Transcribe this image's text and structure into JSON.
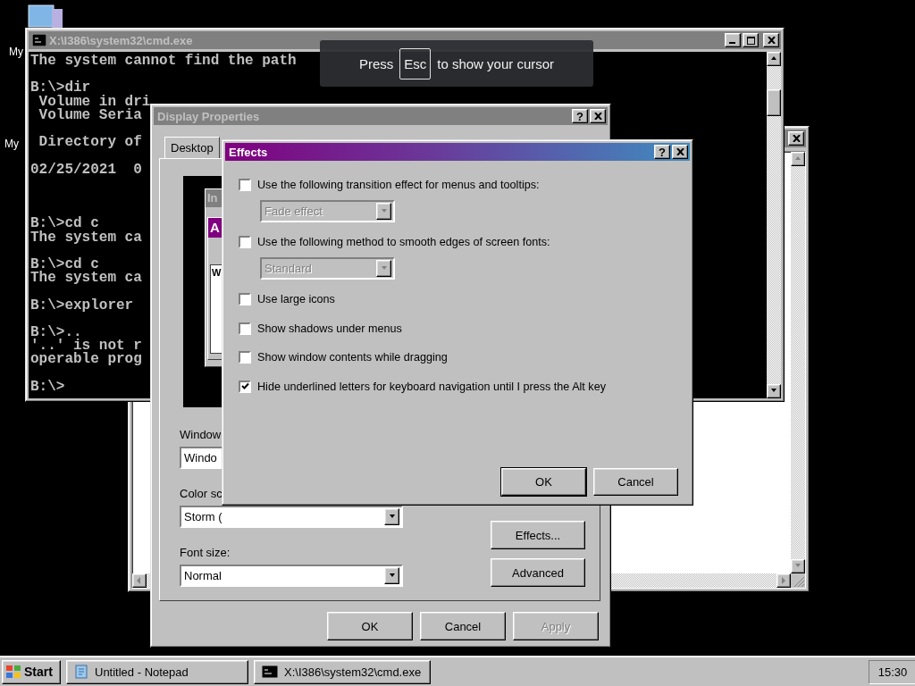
{
  "desktop": {
    "icon_labels": [
      "My",
      "My"
    ]
  },
  "cmd_window": {
    "title": "X:\\I386\\system32\\cmd.exe",
    "active": false,
    "blocks": [
      {
        "kind": "command",
        "lines": [
          "The system cannot find the path"
        ]
      },
      {
        "kind": "command",
        "lines": [
          "B:\\>dir",
          " Volume in dri",
          " Volume Seria"
        ]
      },
      {
        "kind": "command",
        "lines": [
          " Directory of"
        ]
      },
      {
        "kind": "listing",
        "lines": [
          "02/25/2021  0"
        ]
      },
      {
        "kind": "command",
        "lines": [
          "B:\\>cd c",
          "The system ca"
        ]
      },
      {
        "kind": "command",
        "lines": [
          "B:\\>cd c",
          "The system ca"
        ]
      },
      {
        "kind": "command",
        "lines": [
          "B:\\>explorer"
        ]
      },
      {
        "kind": "command",
        "lines": [
          "B:\\>..",
          "'..' is not r",
          "operable prog"
        ]
      },
      {
        "kind": "command",
        "lines": [
          "B:\\>"
        ]
      }
    ]
  },
  "display_properties": {
    "title": "Display Properties",
    "active": false,
    "tabs": [
      {
        "label": "Desktop",
        "selected": false
      }
    ],
    "preview": {
      "inactive_title": "In",
      "active_title": "A",
      "window_text": "W"
    },
    "help_button": "?",
    "fields": [
      {
        "label": "Window",
        "value": "Windo"
      },
      {
        "label": "Color sc",
        "value": "Storm ("
      },
      {
        "label": "Font size:",
        "value": "Normal"
      }
    ],
    "side_buttons": [
      "Effects...",
      "Advanced"
    ],
    "buttons": [
      {
        "label": "OK",
        "disabled": false
      },
      {
        "label": "Cancel",
        "disabled": false
      },
      {
        "label": "Apply",
        "disabled": true
      }
    ]
  },
  "effects_dialog": {
    "title": "Effects",
    "active": true,
    "help_button": "?",
    "options": [
      {
        "kind": "checkbox",
        "label": "Use the following transition effect for menus and tooltips:",
        "checked": false
      },
      {
        "kind": "dropdown",
        "value": "Fade effect",
        "disabled": true
      },
      {
        "kind": "checkbox",
        "label": "Use the following method to smooth edges of screen fonts:",
        "checked": false
      },
      {
        "kind": "dropdown",
        "value": "Standard",
        "disabled": true
      },
      {
        "kind": "checkbox",
        "label": "Use large icons",
        "checked": false
      },
      {
        "kind": "checkbox",
        "label": "Show shadows under menus",
        "checked": false
      },
      {
        "kind": "checkbox",
        "label": "Show window contents while dragging",
        "checked": false
      },
      {
        "kind": "checkbox",
        "label": "Hide underlined letters for keyboard navigation until I press the Alt key",
        "checked": true
      }
    ],
    "buttons": [
      {
        "label": "OK",
        "default": true
      },
      {
        "label": "Cancel",
        "default": false
      }
    ]
  },
  "cursor_hint": {
    "before": "Press",
    "key": "Esc",
    "after": "to show your cursor"
  },
  "taskbar": {
    "start": "Start",
    "tasks": [
      {
        "kind": "notepad",
        "label": "Untitled - Notepad",
        "selected": false
      },
      {
        "kind": "console",
        "label": "X:\\I386\\system32\\cmd.exe",
        "selected": false
      }
    ],
    "clock": "15:30"
  }
}
